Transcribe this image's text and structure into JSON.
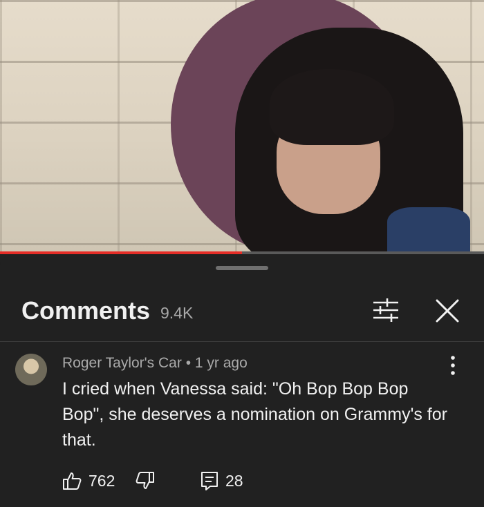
{
  "video": {
    "progress_fraction": 0.5,
    "accent_color": "#e52d27"
  },
  "comments_panel": {
    "title": "Comments",
    "count": "9.4K",
    "icons": {
      "filter": "filter-sliders-icon",
      "close": "close-icon"
    }
  },
  "comment": {
    "author": "Roger Taylor's Car",
    "separator": "•",
    "age": "1 yr ago",
    "text": "I cried when Vanessa said: \"Oh Bop Bop Bop Bop\", she deserves a nomination on Grammy's for that.",
    "likes": "762",
    "replies": "28",
    "icons": {
      "like": "thumbs-up-icon",
      "dislike": "thumbs-down-icon",
      "reply": "reply-icon",
      "menu": "more-vertical-icon"
    }
  }
}
